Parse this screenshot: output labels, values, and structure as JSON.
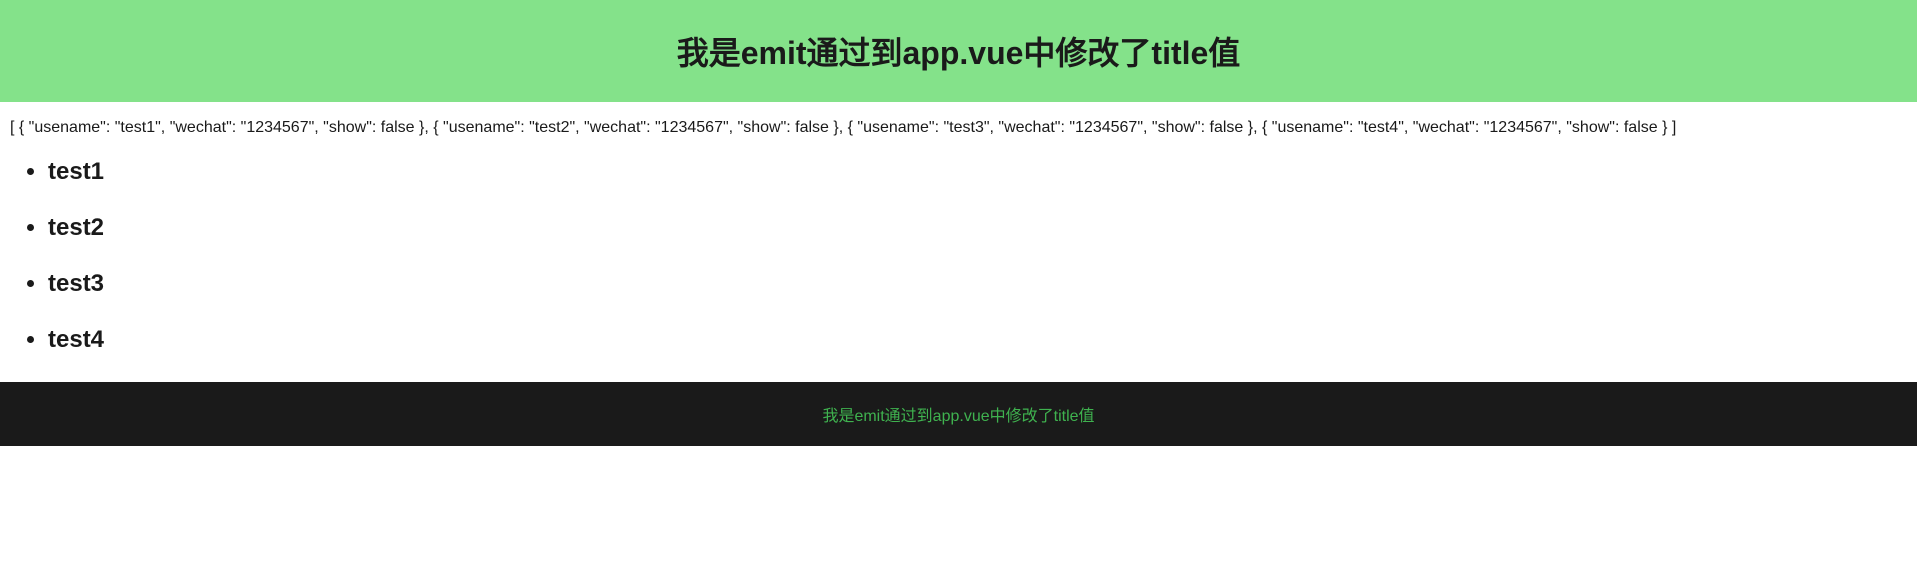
{
  "header": {
    "title": "我是emit通过到app.vue中修改了title值"
  },
  "json_display": "[ { \"usename\": \"test1\", \"wechat\": \"1234567\", \"show\": false }, { \"usename\": \"test2\", \"wechat\": \"1234567\", \"show\": false }, { \"usename\": \"test3\", \"wechat\": \"1234567\", \"show\": false }, { \"usename\": \"test4\", \"wechat\": \"1234567\", \"show\": false } ]",
  "users": [
    {
      "name": "test1"
    },
    {
      "name": "test2"
    },
    {
      "name": "test3"
    },
    {
      "name": "test4"
    }
  ],
  "footer": {
    "text": "我是emit通过到app.vue中修改了title值"
  }
}
